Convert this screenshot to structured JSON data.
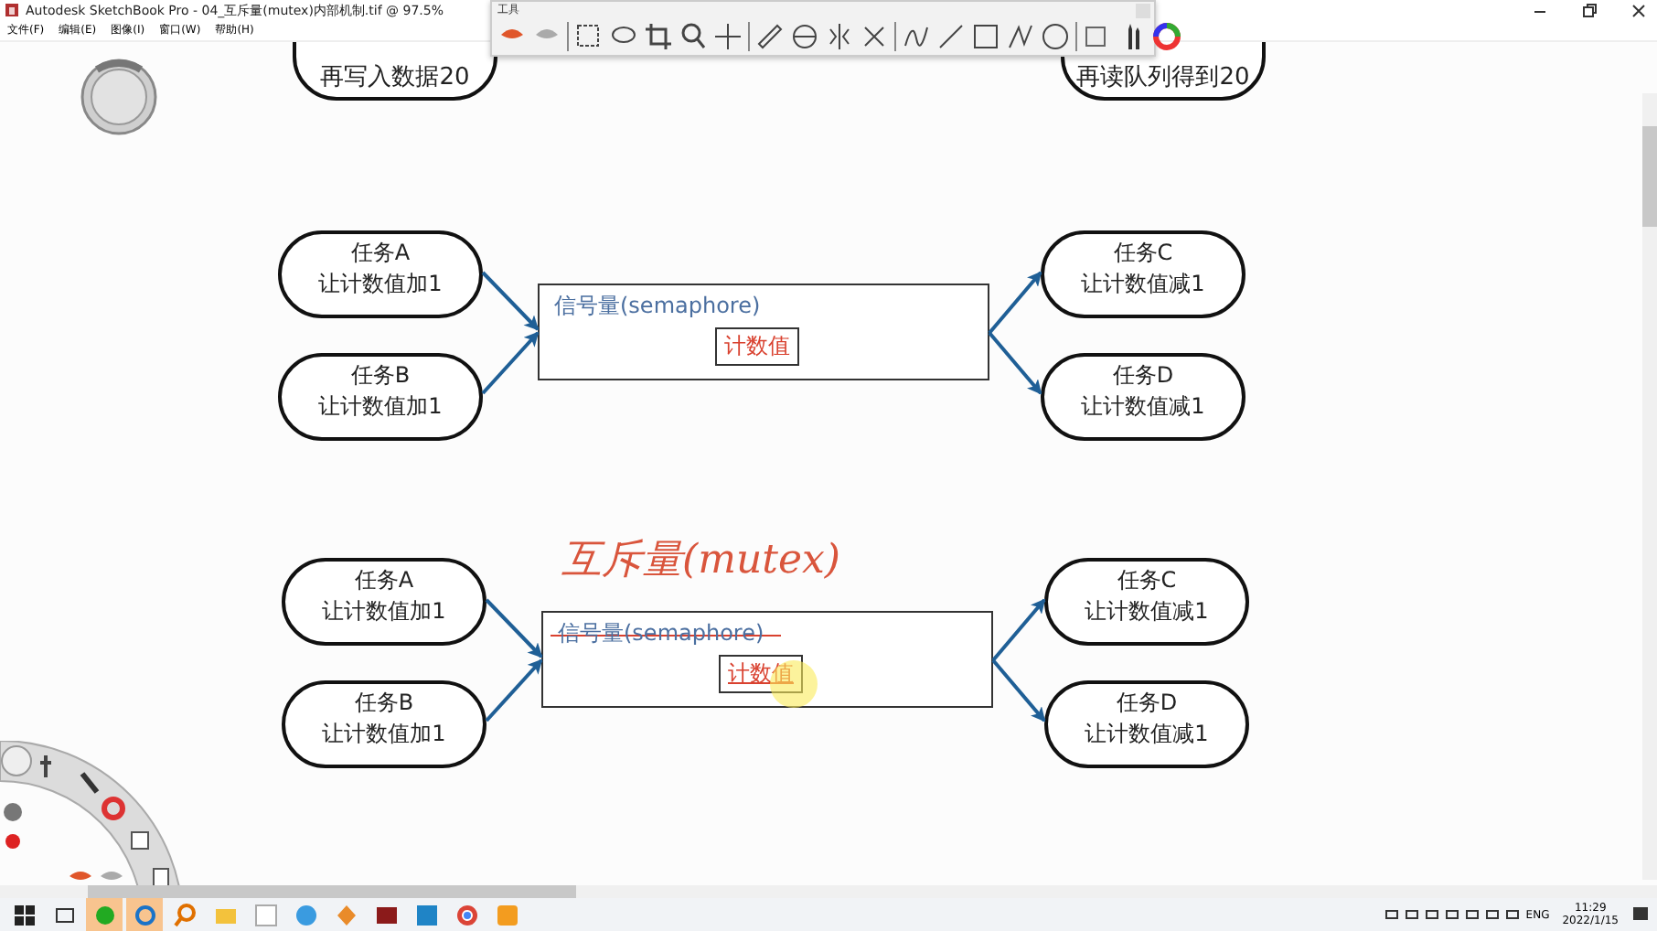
{
  "window": {
    "title": "Autodesk SketchBook Pro - 04_互斥量(mutex)内部机制.tif @ 97.5%"
  },
  "menu": [
    {
      "label": "文件(F)"
    },
    {
      "label": "编辑(E)"
    },
    {
      "label": "图像(I)"
    },
    {
      "label": "窗口(W)"
    },
    {
      "label": "帮助(H)"
    }
  ],
  "toolbar": {
    "title": "工具"
  },
  "canvas": {
    "top_nodes": [
      {
        "text": "再写入数据20"
      },
      {
        "text": "再读队列得到20"
      }
    ],
    "diagrams": [
      {
        "inputs": [
          {
            "title": "任务A",
            "action": "让计数值加1"
          },
          {
            "title": "任务B",
            "action": "让计数值加1"
          }
        ],
        "box": {
          "label": "信号量(semaphore)",
          "counter": "计数值",
          "struck": false,
          "underlined": false
        },
        "outputs": [
          {
            "title": "任务C",
            "action": "让计数值减1"
          },
          {
            "title": "任务D",
            "action": "让计数值减1"
          }
        ]
      },
      {
        "annotation": "互斥量(mutex)",
        "inputs": [
          {
            "title": "任务A",
            "action": "让计数值加1"
          },
          {
            "title": "任务B",
            "action": "让计数值加1"
          }
        ],
        "box": {
          "label": "信号量(semaphore)",
          "counter": "计数值",
          "struck": true,
          "underlined": true
        },
        "outputs": [
          {
            "title": "任务C",
            "action": "让计数值减1"
          },
          {
            "title": "任务D",
            "action": "让计数值减1"
          }
        ]
      }
    ]
  },
  "taskbar": {
    "language": "ENG",
    "time": "11:29",
    "date": "2022/1/15"
  }
}
